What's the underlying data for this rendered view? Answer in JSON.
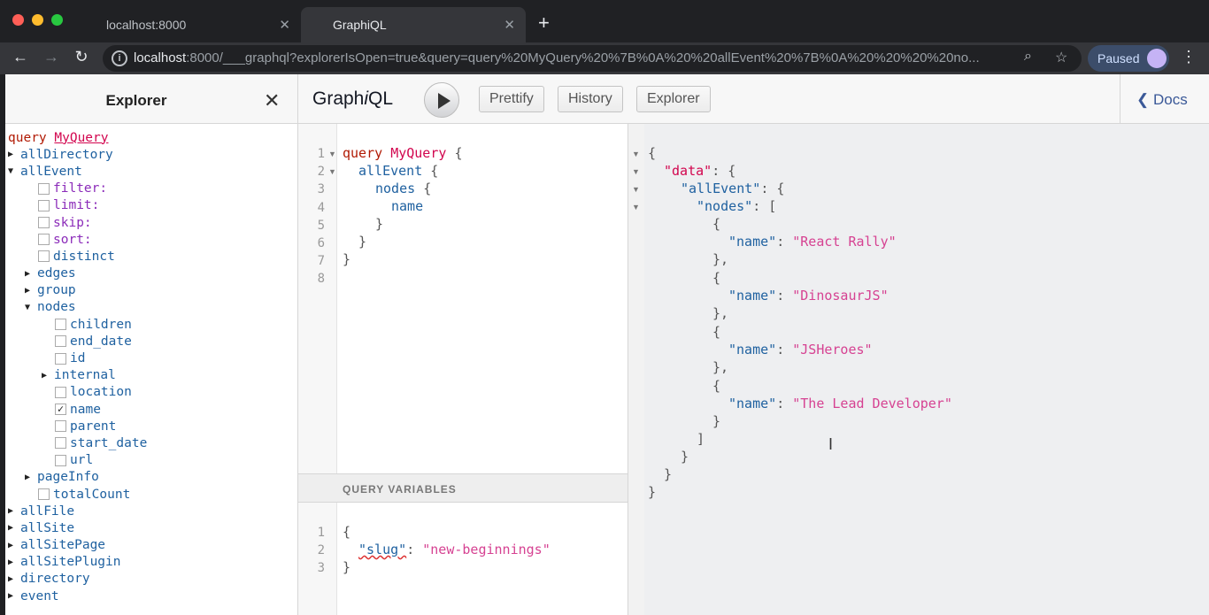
{
  "browser": {
    "tabs": [
      {
        "label": "localhost:8000"
      },
      {
        "label": "GraphiQL"
      }
    ],
    "url_host": "localhost",
    "url_rest": ":8000/___graphql?explorerIsOpen=true&query=query%20MyQuery%20%7B%0A%20%20allEvent%20%7B%0A%20%20%20%20no...",
    "paused_label": "Paused"
  },
  "explorer": {
    "title": "Explorer",
    "query_keyword": "query",
    "query_name": "MyQuery",
    "fields": [
      {
        "label": "allDirectory",
        "kind": "collapsed",
        "indent": 0
      },
      {
        "label": "allEvent",
        "kind": "expanded",
        "indent": 0
      },
      {
        "label": "filter:",
        "kind": "arg",
        "indent": 1
      },
      {
        "label": "limit:",
        "kind": "arg",
        "indent": 1
      },
      {
        "label": "skip:",
        "kind": "arg",
        "indent": 1
      },
      {
        "label": "sort:",
        "kind": "arg",
        "indent": 1
      },
      {
        "label": "distinct",
        "kind": "check",
        "indent": 1
      },
      {
        "label": "edges",
        "kind": "collapsed",
        "indent": 1
      },
      {
        "label": "group",
        "kind": "collapsed",
        "indent": 1
      },
      {
        "label": "nodes",
        "kind": "expanded",
        "indent": 1
      },
      {
        "label": "children",
        "kind": "check",
        "indent": 2
      },
      {
        "label": "end_date",
        "kind": "check",
        "indent": 2
      },
      {
        "label": "id",
        "kind": "check",
        "indent": 2
      },
      {
        "label": "internal",
        "kind": "collapsed",
        "indent": 2
      },
      {
        "label": "location",
        "kind": "check",
        "indent": 2
      },
      {
        "label": "name",
        "kind": "checked",
        "indent": 2
      },
      {
        "label": "parent",
        "kind": "check",
        "indent": 2
      },
      {
        "label": "start_date",
        "kind": "check",
        "indent": 2
      },
      {
        "label": "url",
        "kind": "check",
        "indent": 2
      },
      {
        "label": "pageInfo",
        "kind": "collapsed",
        "indent": 1
      },
      {
        "label": "totalCount",
        "kind": "check",
        "indent": 1
      },
      {
        "label": "allFile",
        "kind": "collapsed",
        "indent": 0
      },
      {
        "label": "allSite",
        "kind": "collapsed",
        "indent": 0
      },
      {
        "label": "allSitePage",
        "kind": "collapsed",
        "indent": 0
      },
      {
        "label": "allSitePlugin",
        "kind": "collapsed",
        "indent": 0
      },
      {
        "label": "directory",
        "kind": "collapsed",
        "indent": 0
      },
      {
        "label": "event",
        "kind": "collapsed",
        "indent": 0
      }
    ]
  },
  "toolbar": {
    "title_pre": "Graph",
    "title_i": "i",
    "title_post": "QL",
    "prettify": "Prettify",
    "history": "History",
    "explorer": "Explorer",
    "docs": "Docs"
  },
  "query_editor": {
    "line_numbers": [
      "1",
      "2",
      "3",
      "4",
      "5",
      "6",
      "7",
      "8"
    ],
    "kw": "query",
    "op": "MyQuery",
    "brace_open": "{",
    "brace_close": "}",
    "f1": "allEvent",
    "f2": "nodes",
    "f3": "name"
  },
  "variables": {
    "header": "QUERY VARIABLES",
    "line_numbers": [
      "1",
      "2",
      "3"
    ],
    "key": "\"slug\"",
    "colon": ":",
    "value": "\"new-beginnings\""
  },
  "result": {
    "k_data": "\"data\"",
    "k_allEvent": "\"allEvent\"",
    "k_nodes": "\"nodes\"",
    "k_name": "\"name\"",
    "names": [
      "\"React Rally\"",
      "\"DinosaurJS\"",
      "\"JSHeroes\"",
      "\"The Lead Developer\""
    ]
  }
}
